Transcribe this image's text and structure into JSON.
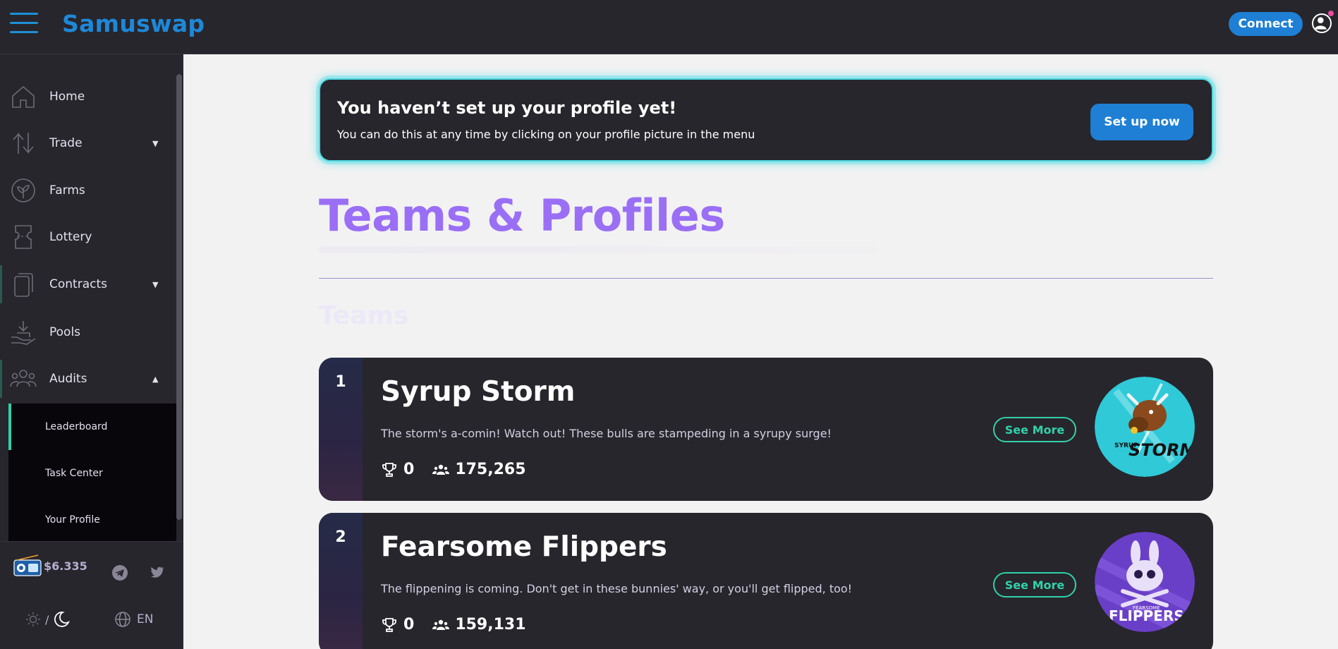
{
  "header": {
    "brand": "Samuswap",
    "connect_label": "Connect"
  },
  "sidebar": {
    "items": [
      {
        "label": "Home",
        "icon": "home-icon"
      },
      {
        "label": "Trade",
        "icon": "trade-icon",
        "expandable": true
      },
      {
        "label": "Farms",
        "icon": "farms-icon"
      },
      {
        "label": "Lottery",
        "icon": "lottery-ticket-icon"
      },
      {
        "label": "Contracts",
        "icon": "contracts-icon",
        "expandable": true
      },
      {
        "label": "Pools",
        "icon": "pools-icon"
      },
      {
        "label": "Audits",
        "icon": "audits-icon",
        "expanded": true
      }
    ],
    "submenu": [
      {
        "label": "Leaderboard",
        "active": true
      },
      {
        "label": "Task Center"
      },
      {
        "label": "Your Profile"
      }
    ],
    "footer": {
      "price": "$6.335",
      "language": "EN",
      "theme_separator": "/"
    }
  },
  "banner": {
    "title": "You haven’t set up your profile yet!",
    "subtitle": "You can do this at any time by clicking on your profile picture in the menu",
    "button_label": "Set up now"
  },
  "page": {
    "title": "Teams & Profiles",
    "section_title": "Teams"
  },
  "teams": [
    {
      "rank": "1",
      "name": "Syrup Storm",
      "description": "The storm's a-comin! Watch out! These bulls are stampeding in a syrupy surge!",
      "points": "0",
      "members": "175,265",
      "see_more": "See More",
      "logo_text": "STORM",
      "logo_small": "SYRUP"
    },
    {
      "rank": "2",
      "name": "Fearsome Flippers",
      "description": "The flippening is coming. Don't get in these bunnies' way, or you'll get flipped, too!",
      "points": "0",
      "members": "159,131",
      "see_more": "See More",
      "logo_text": "FLIPPERS",
      "logo_small": "FEARSOME"
    }
  ],
  "colors": {
    "accent_blue": "#1e7fd4",
    "purple": "#9a6ff5",
    "teal": "#31d0aa",
    "card_bg": "#27262c"
  }
}
